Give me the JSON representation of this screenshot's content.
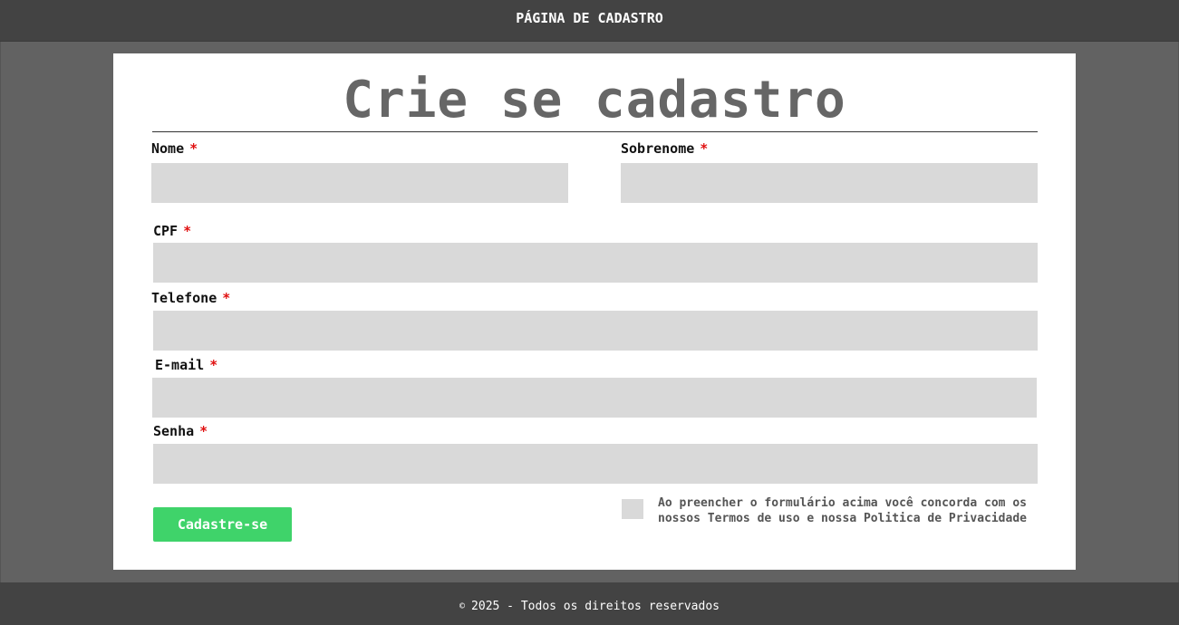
{
  "header": {
    "title": "PÁGINA DE CADASTRO"
  },
  "form": {
    "title": "Crie se cadastro",
    "required_marker": "*",
    "fields": {
      "nome": {
        "label": "Nome",
        "value": ""
      },
      "sobrenome": {
        "label": "Sobrenome",
        "value": ""
      },
      "cpf": {
        "label": "CPF",
        "value": ""
      },
      "telefone": {
        "label": "Telefone",
        "value": ""
      },
      "email": {
        "label": "E-mail",
        "value": ""
      },
      "senha": {
        "label": "Senha",
        "value": ""
      }
    },
    "submit_label": "Cadastre-se",
    "terms": {
      "checked": false,
      "text": "Ao preencher o formulário acima você concorda com os nossos Termos de uso e nossa Politica de Privacidade"
    }
  },
  "footer": {
    "copyright_symbol": "©",
    "text": "2025 - Todos os direitos reservados"
  },
  "colors": {
    "header_bg": "#434343",
    "page_bg": "#626262",
    "card_bg": "#ffffff",
    "input_bg": "#d9d9d9",
    "title_color": "#666666",
    "required_color": "#e01010",
    "button_bg": "#3fd36a"
  }
}
